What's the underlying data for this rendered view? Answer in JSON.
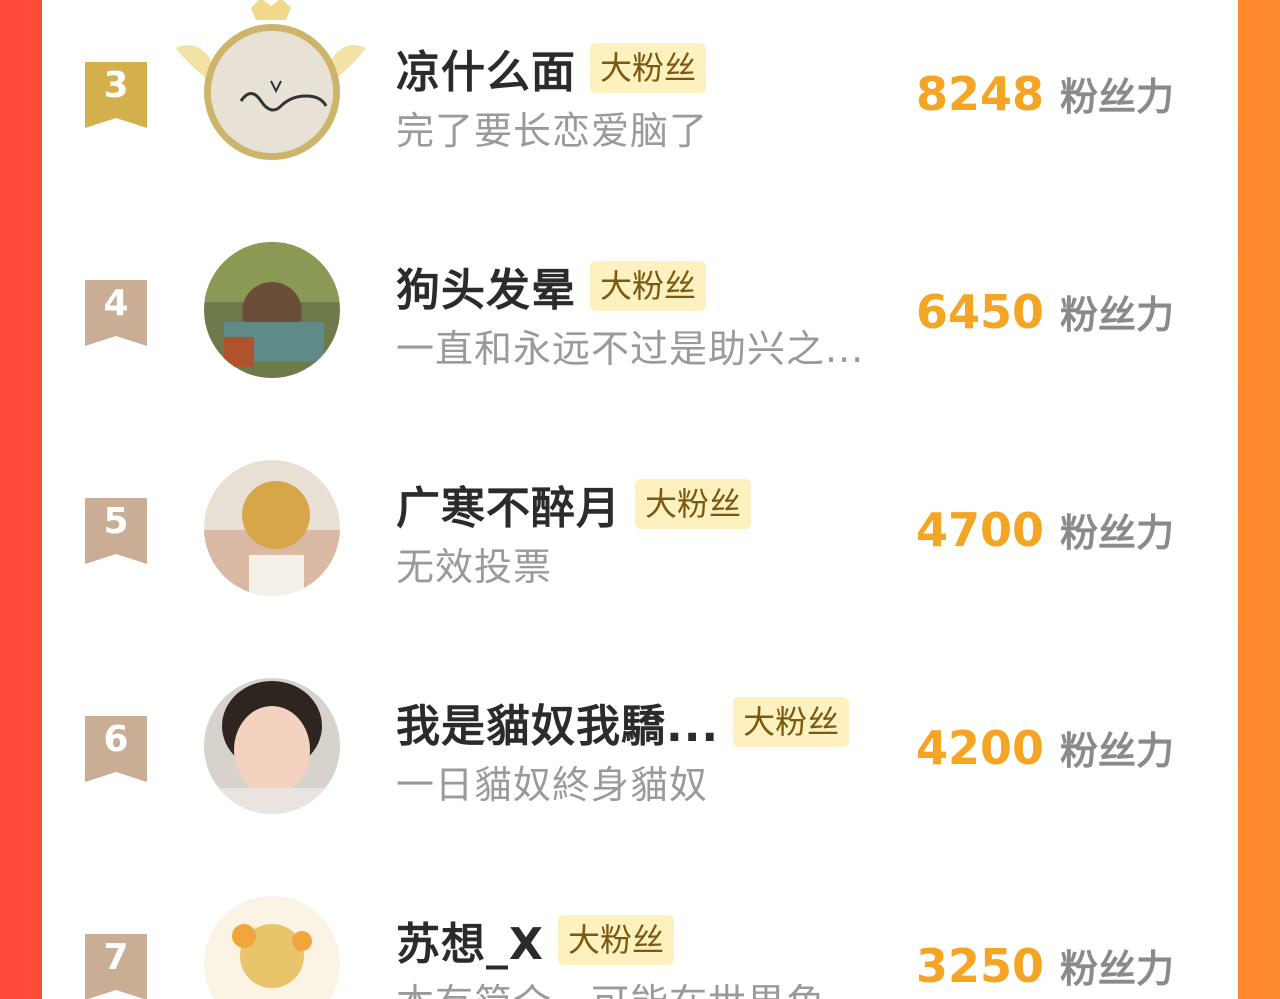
{
  "colors": {
    "accent": "#f5a524",
    "badge_bg": "#fdf1bf",
    "rank_gold": "#d4b04c",
    "rank_tan": "#c9ad94"
  },
  "entries": [
    {
      "rank": "3",
      "name": "凉什么面",
      "badge": "大粉丝",
      "bio": "完了要长恋爱脑了",
      "score": "8248",
      "unit": "粉丝力",
      "avatar_icon": "handwriting-avatar-icon"
    },
    {
      "rank": "4",
      "name": "狗头发晕",
      "badge": "大粉丝",
      "bio": "一直和永远不过是助兴之...",
      "score": "6450",
      "unit": "粉丝力",
      "avatar_icon": "anime-boy-sleeping-avatar-icon"
    },
    {
      "rank": "5",
      "name": "广寒不醉月",
      "badge": "大粉丝",
      "bio": "无效投票",
      "score": "4700",
      "unit": "粉丝力",
      "avatar_icon": "anime-boy-golden-hair-avatar-icon"
    },
    {
      "rank": "6",
      "name": "我是貓奴我驕...",
      "badge": "大粉丝",
      "bio": "一日貓奴終身貓奴",
      "score": "4200",
      "unit": "粉丝力",
      "avatar_icon": "girl-peace-sign-avatar-icon"
    },
    {
      "rank": "7",
      "name": "苏想_X",
      "badge": "大粉丝",
      "bio": "本有简介，可能在世界角",
      "score": "3250",
      "unit": "粉丝力",
      "avatar_icon": "anime-character-flowers-avatar-icon"
    }
  ]
}
